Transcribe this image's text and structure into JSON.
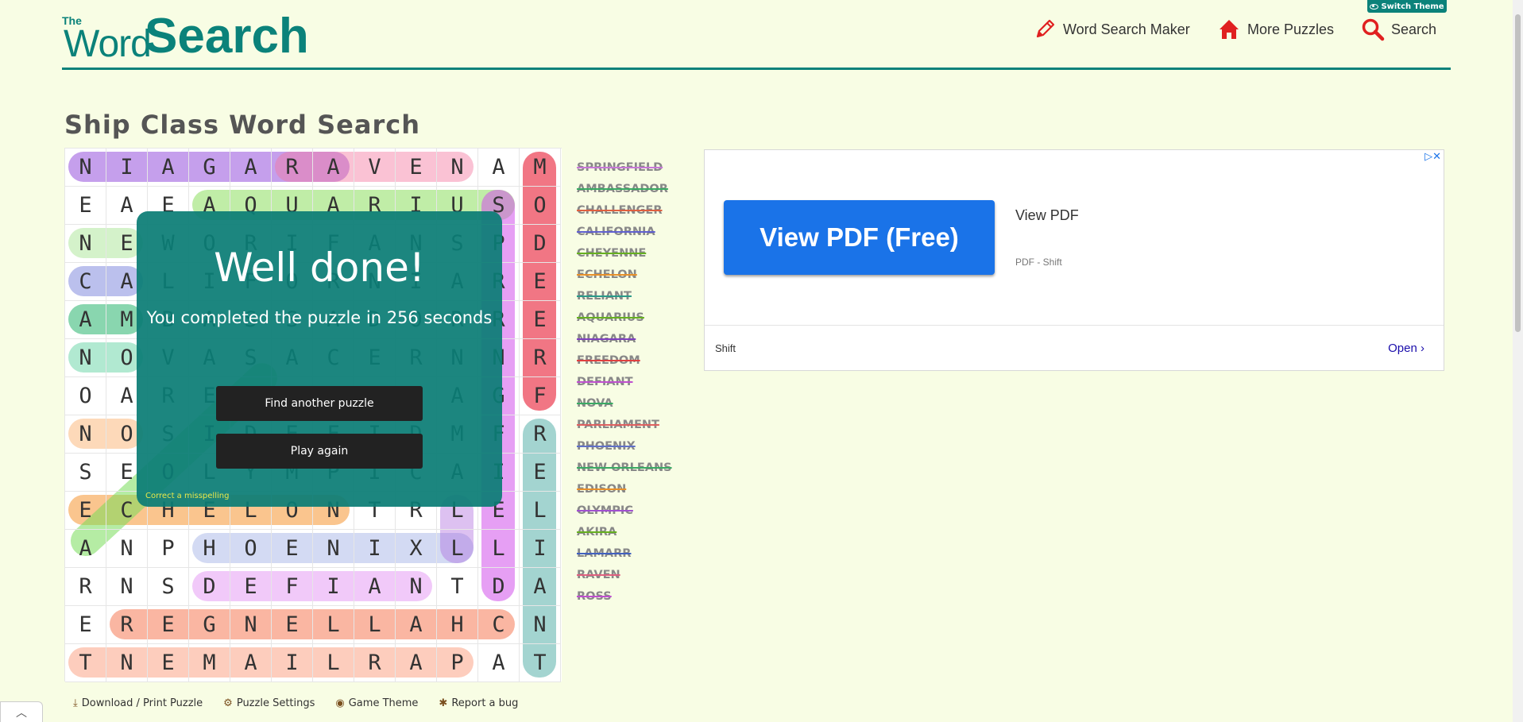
{
  "header": {
    "logo_the": "The",
    "logo_word": "Word",
    "logo_search": "Search",
    "switch_theme": "Switch Theme",
    "nav": [
      {
        "label": "Word Search Maker",
        "icon": "pencil-icon"
      },
      {
        "label": "More Puzzles",
        "icon": "house-icon"
      },
      {
        "label": "Search",
        "icon": "magnifier-icon"
      }
    ]
  },
  "page": {
    "title": "Ship Class Word Search"
  },
  "grid": {
    "rows": [
      "NIAGARAVENAM",
      "EAEAQUARIUSO",
      "NEWORIFANSPD",
      "CALIFORNIARE",
      "AMBASSADORRE",
      "NOVASACERNNR",
      "OAREGNEYNAGF",
      "NOSIDEFIDMFR",
      "SEOLYMPICAIE",
      "ECHELONTRLEL",
      "ANPHOENIXLLI",
      "RNSDEFIANTDA",
      "EREGNELLAHCN",
      "TNEMAILRAPAT"
    ]
  },
  "modal": {
    "title": "Well done!",
    "message": "You completed the puzzle in 256 seconds",
    "find_another": "Find another puzzle",
    "play_again": "Play again",
    "misspelling": "Correct a misspelling"
  },
  "word_list": [
    {
      "word": "SPRINGFIELD",
      "color": "#c878d8"
    },
    {
      "word": "AMBASSADOR",
      "color": "#3aaa64"
    },
    {
      "word": "CHALLENGER",
      "color": "#e06040"
    },
    {
      "word": "CALIFORNIA",
      "color": "#6060d0"
    },
    {
      "word": "CHEYENNE",
      "color": "#66b020"
    },
    {
      "word": "ECHELON",
      "color": "#e8902a"
    },
    {
      "word": "RELIANT",
      "color": "#2a9a8a"
    },
    {
      "word": "AQUARIUS",
      "color": "#66b020"
    },
    {
      "word": "NIAGARA",
      "color": "#8040c0"
    },
    {
      "word": "FREEDOM",
      "color": "#e04040"
    },
    {
      "word": "DEFIANT",
      "color": "#c050d0"
    },
    {
      "word": "NOVA",
      "color": "#3aaa64"
    },
    {
      "word": "PARLIAMENT",
      "color": "#e06060"
    },
    {
      "word": "PHOENIX",
      "color": "#6070c8"
    },
    {
      "word": "NEW ORLEANS",
      "color": "#3aaa64"
    },
    {
      "word": "EDISON",
      "color": "#e8902a"
    },
    {
      "word": "OLYMPIC",
      "color": "#a050d0"
    },
    {
      "word": "AKIRA",
      "color": "#66b020"
    },
    {
      "word": "LAMARR",
      "color": "#4060c0"
    },
    {
      "word": "RAVEN",
      "color": "#e06080"
    },
    {
      "word": "ROSS",
      "color": "#c050d0"
    }
  ],
  "ad": {
    "button": "View PDF (Free)",
    "title": "View PDF",
    "subtitle": "PDF - Shift",
    "brand": "Shift",
    "open": "Open"
  },
  "footer": {
    "links": [
      {
        "label": "Download / Print Puzzle",
        "icon": "download-icon"
      },
      {
        "label": "Puzzle Settings",
        "icon": "gear-icon"
      },
      {
        "label": "Game Theme",
        "icon": "eye-icon"
      },
      {
        "label": "Report a bug",
        "icon": "bug-icon"
      }
    ]
  },
  "colors": {
    "brand": "#0b827a",
    "background": "#f8fde4",
    "ad_button": "#1a73e8"
  }
}
